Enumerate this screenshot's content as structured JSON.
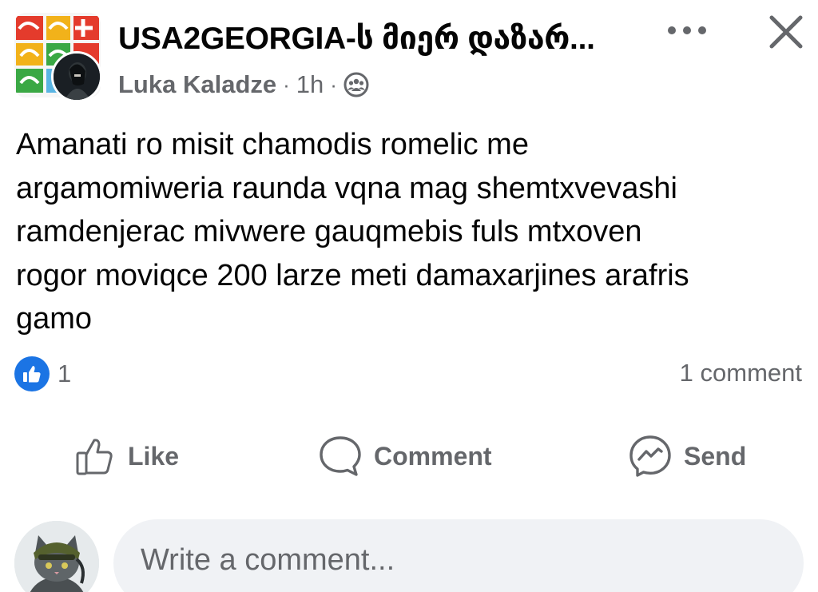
{
  "post": {
    "group_name": "USA2GEORGIA-ს მიერ დაზარ...",
    "author": "Luka Kaladze",
    "separator": "·",
    "time": "1h",
    "text": "Amanati ro misit chamodis romelic me\nargamomiweria raunda vqna mag shemtxvevashi\nramdenjerac mivwere gauqmebis fuls mtxoven\nrogor moviqce 200 larze meti damaxarjines arafris\ngamo"
  },
  "icons": {
    "more": "more-options-icon",
    "close": "close-icon",
    "privacy": "group-members-icon",
    "like": "thumbs-up-icon",
    "comment": "speech-bubble-icon",
    "send": "messenger-icon"
  },
  "reactions": {
    "count": "1",
    "comments": "1 comment"
  },
  "actions": {
    "like": "Like",
    "comment": "Comment",
    "send": "Send"
  },
  "composer": {
    "placeholder": "Write a comment..."
  },
  "colors": {
    "text": "#050505",
    "secondary": "#65676b",
    "like_blue": "#1b74e4",
    "composer_bg": "#f0f2f5"
  }
}
